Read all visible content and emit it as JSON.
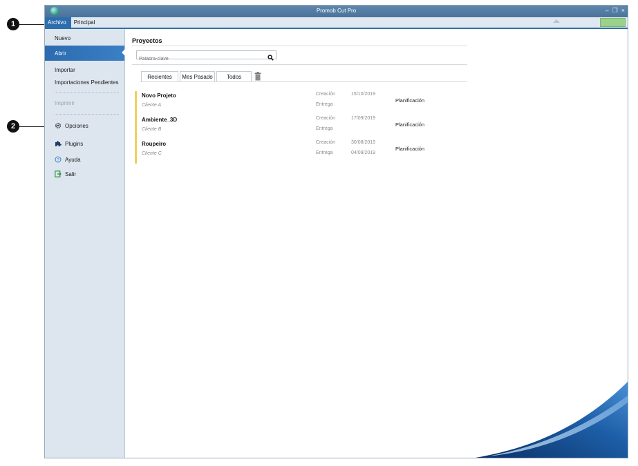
{
  "window": {
    "title": "Promob Cut Pro",
    "controls": [
      "–",
      "❐",
      "×"
    ]
  },
  "menubar": {
    "items": [
      {
        "label": "Archivo",
        "active": true
      },
      {
        "label": "Principal",
        "active": false
      }
    ],
    "right_button": ""
  },
  "callouts": [
    "1",
    "2"
  ],
  "sidebar": {
    "nuevo": "Nuevo",
    "abrir": "Abrir",
    "importar": "Importar",
    "importaciones": "Importaciones Pendientes",
    "imprimir": "Imprimir",
    "opciones": "Opciones",
    "plugins": "Plugins",
    "ayuda": "Ayuda",
    "salir": "Salir"
  },
  "main": {
    "title": "Proyectos",
    "search_placeholder": "Palabra-clave",
    "tabs": [
      "Recientes",
      "Mes Pasado",
      "Todos"
    ]
  },
  "projects": [
    {
      "name": "Novo Projeto",
      "client": "Cliente A",
      "label1": "Creación",
      "label2": "Entrega",
      "date1": "15/10/2019",
      "date2": "",
      "status": "Planificación"
    },
    {
      "name": "Ambiente_3D",
      "client": "Cliente B",
      "label1": "Creación",
      "label2": "Entrega",
      "date1": "17/09/2019",
      "date2": "",
      "status": "Planificación"
    },
    {
      "name": "Roupeiro",
      "client": "Cliente C",
      "label1": "Creación",
      "label2": "Entrega",
      "date1": "30/08/2019",
      "date2": "04/09/2019",
      "status": "Planificación"
    }
  ],
  "colors": {
    "accent": "#2d6fae",
    "project_marker": "#f0cf5c",
    "sidebar_bg": "#dde6ef"
  },
  "icons": {
    "search": "search-icon",
    "trash": "trash-icon",
    "options": "gear-icon",
    "plugins": "puzzle-icon",
    "help": "help-icon",
    "exit": "exit-icon"
  }
}
